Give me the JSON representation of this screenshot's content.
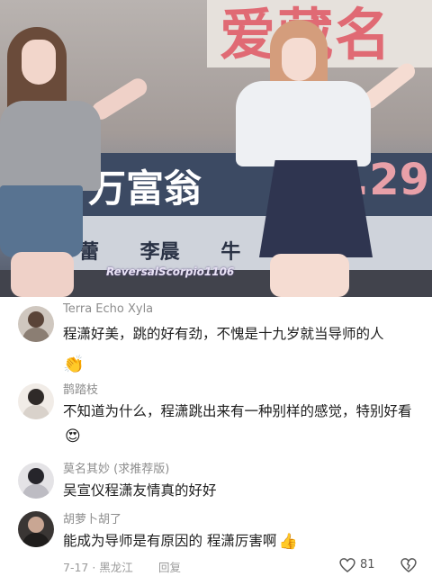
{
  "video": {
    "banner_text": "爱藏名",
    "big_text": "万富翁",
    "date_text": ".29",
    "names_text": "蕾 李晨 牛",
    "watermark": "ReversalScorpio1106"
  },
  "comments": [
    {
      "username": "Terra Echo Xyla",
      "text": "程潇好美，跳的好有劲，不愧是十九岁就当导师的人",
      "emoji": "👏",
      "avatar_icon": "user-avatar-icon"
    },
    {
      "username": "鹊踏枝",
      "text": "不知道为什么，程潇跳出来有一种别样的感觉，特别好看",
      "emoji": "😍",
      "avatar_icon": "user-avatar-icon"
    },
    {
      "username": "莫名其妙 (求推荐版)",
      "text": "吴宣仪程潇友情真的好好",
      "emoji": "",
      "avatar_icon": "user-avatar-icon"
    },
    {
      "username": "胡萝卜胡了",
      "text": "能成为导师是有原因的 程潇厉害啊",
      "emoji": "👍",
      "avatar_icon": "user-avatar-icon"
    }
  ],
  "meta": {
    "date_location": "7-17 · 黑龙江",
    "reply_label": "回复",
    "like_count": "81",
    "like_icon": "heart-icon",
    "dislike_icon": "dislike-icon"
  },
  "colors": {
    "username": "#8d8d8d",
    "text": "#1d1d1d",
    "meta": "#9a9a9a"
  }
}
